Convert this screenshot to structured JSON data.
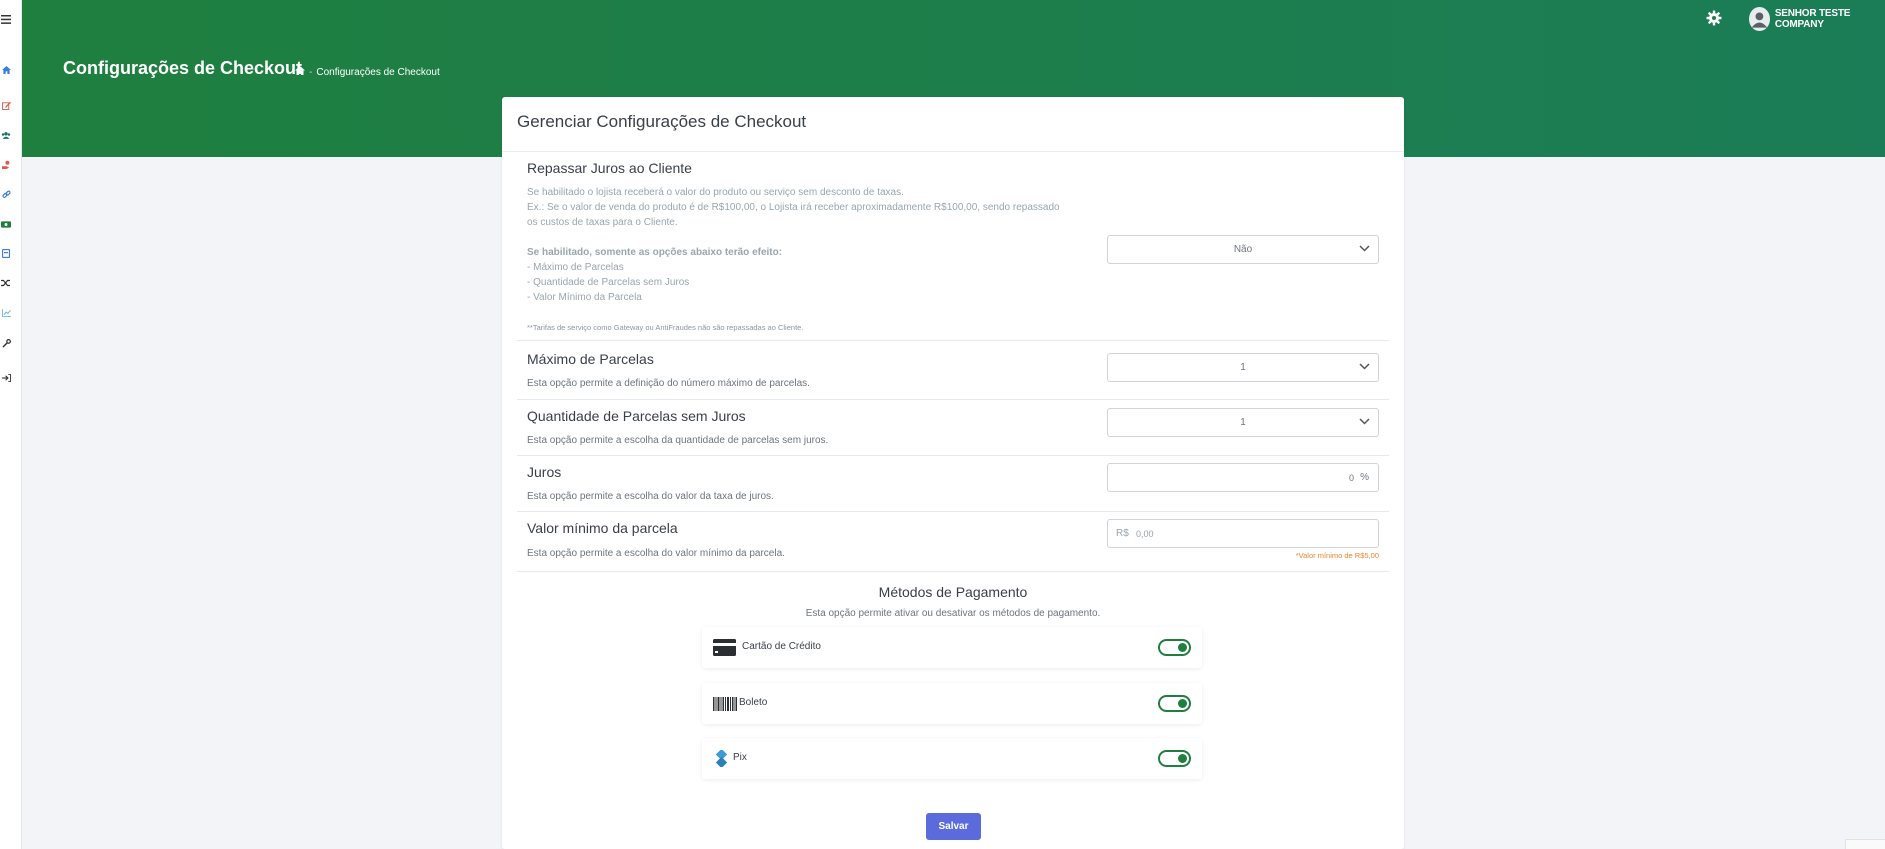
{
  "header": {
    "page_title": "Configurações de Checkout",
    "breadcrumb": {
      "separator": "-",
      "current": "Configurações de Checkout"
    },
    "user_name": "SENHOR TESTE COMPANY"
  },
  "card": {
    "title": "Gerenciar Configurações de Checkout",
    "repassar": {
      "title": "Repassar Juros ao Cliente",
      "desc_line1": "Se habilitado o lojista receberá o valor do produto ou serviço sem desconto de taxas.",
      "desc_line2": "Ex.: Se o valor de venda do produto é de R$100,00, o Lojista irá receber aproximadamente R$100,00, sendo repassado",
      "desc_line3": "os custos de taxas para o Cliente.",
      "effect_title": "Se habilitado, somente as opções abaixo terão efeito:",
      "effect_1": "- Máximo de Parcelas",
      "effect_2": "- Quantidade de Parcelas sem Juros",
      "effect_3": "- Valor Mínimo da Parcela",
      "note": "**Tarifas de serviço como Gateway ou AntiFraudes não são repassadas ao Cliente.",
      "selected": "Não"
    },
    "max_parcelas": {
      "title": "Máximo de Parcelas",
      "desc": "Esta opção permite a definição do número máximo de parcelas.",
      "selected": "1"
    },
    "parcelas_sem_juros": {
      "title": "Quantidade de Parcelas sem Juros",
      "desc": "Esta opção permite a escolha da quantidade de parcelas sem juros.",
      "selected": "1"
    },
    "juros": {
      "title": "Juros",
      "desc": "Esta opção permite a escolha do valor da taxa de juros.",
      "value": "0",
      "unit": "%"
    },
    "valor_minimo": {
      "title": "Valor mínimo da parcela",
      "desc": "Esta opção permite a escolha do valor mínimo da parcela.",
      "prefix": "R$",
      "placeholder": "0,00",
      "hint": "*Valor mínimo de R$5,00"
    },
    "payment_methods": {
      "title": "Métodos de Pagamento",
      "desc": "Esta opção permite ativar ou desativar os métodos de pagamento.",
      "items": [
        {
          "label": "Cartão de Crédito",
          "enabled": true,
          "icon": "credit-card-icon"
        },
        {
          "label": "Boleto",
          "enabled": true,
          "icon": "barcode-icon"
        },
        {
          "label": "Pix",
          "enabled": true,
          "icon": "pix-icon"
        }
      ]
    },
    "save_label": "Salvar"
  },
  "colors": {
    "header_start": "#1f7f3f",
    "header_end": "#1b7d57",
    "toggle_on": "#1f7f3f",
    "save_button": "#5c6bdb",
    "hint": "#e8862d"
  }
}
